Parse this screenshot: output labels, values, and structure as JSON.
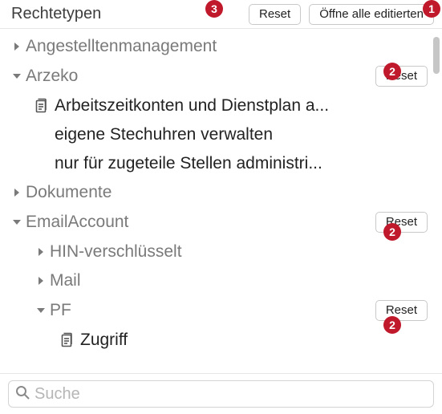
{
  "header": {
    "title": "Rechtetypen",
    "reset": "Reset",
    "open_all": "Öffne alle editierten"
  },
  "tree": {
    "angestellten": {
      "label": "Angestelltenmanagement"
    },
    "arzeko": {
      "label": "Arzeko",
      "reset": "Reset",
      "items": [
        "Arbeitszeitkonten und Dienstplan a...",
        "eigene Stechuhren verwalten",
        "nur für zugeteile Stellen administri..."
      ]
    },
    "dokumente": {
      "label": "Dokumente"
    },
    "emailaccount": {
      "label": "EmailAccount",
      "reset": "Reset",
      "hin": {
        "label": "HIN-verschlüsselt"
      },
      "mail": {
        "label": "Mail"
      },
      "pf": {
        "label": "PF",
        "reset": "Reset",
        "zugriff": "Zugriff"
      }
    }
  },
  "search": {
    "placeholder": "Suche"
  },
  "callouts": {
    "c1": "1",
    "c2": "2",
    "c3": "3"
  }
}
